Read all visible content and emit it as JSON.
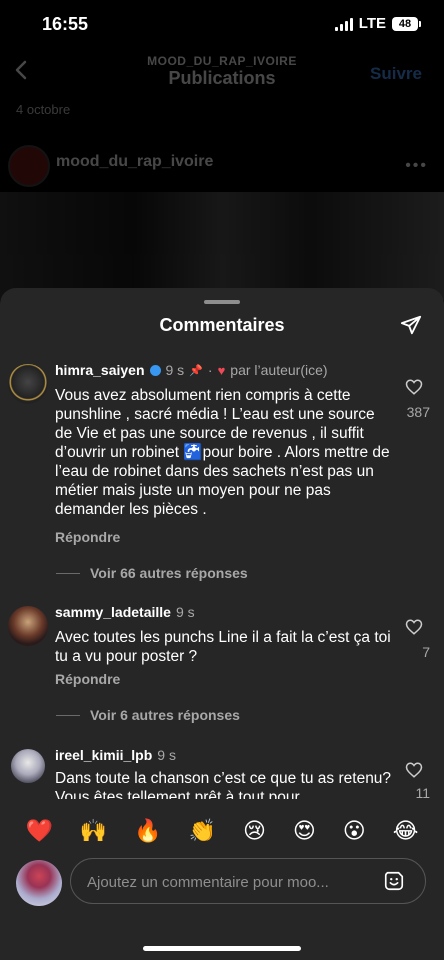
{
  "status_bar": {
    "time": "16:55",
    "network": "LTE",
    "battery": "48"
  },
  "background": {
    "nav_subtitle": "MOOD_DU_RAP_IVOIRE",
    "nav_title": "Publications",
    "follow": "Suivre",
    "date": "4 octobre",
    "post_user": "mood_du_rap_ivoire"
  },
  "sheet": {
    "title": "Commentaires",
    "comments": [
      {
        "user": "himra_saiyen",
        "time": "9 s",
        "author_like": "par l’auteur(ice)",
        "text": "Vous avez absolument rien compris à cette punshline , sacré média !  L’eau est une source de Vie et pas une source de revenus , il suffit d’ouvrir un robinet 🚰pour boire . Alors mettre de l’eau de robinet dans des sachets n’est pas un métier mais juste un moyen pour ne pas demander les pièces .",
        "reply": "Répondre",
        "likes": "387",
        "more_replies": "Voir 66 autres réponses"
      },
      {
        "user": "sammy_ladetaille",
        "time": "9 s",
        "text": "Avec toutes les punchs Line il a fait la c’est ça toi tu a vu pour poster ?",
        "reply": "Répondre",
        "likes": "7",
        "more_replies": "Voir 6 autres réponses"
      },
      {
        "user": "ireel_kimii_lpb",
        "time": "9 s",
        "text": "Dans toute la chanson c’est ce que tu as retenu? Vous êtes tellement prêt à tout pour",
        "likes": "11"
      }
    ],
    "emojis": [
      "❤️",
      "🙌",
      "🔥",
      "👏",
      "😢",
      "😍",
      "😮",
      "😂"
    ],
    "input_placeholder": "Ajoutez un commentaire pour moo..."
  }
}
